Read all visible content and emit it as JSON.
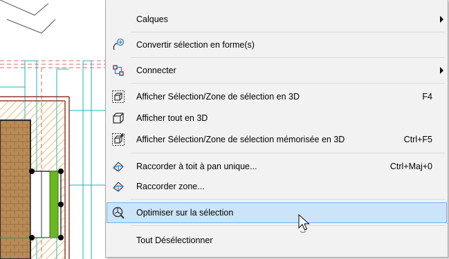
{
  "menu": {
    "items": [
      {
        "label": "Calques",
        "submenu": true
      },
      {
        "label": "Convertir sélection en forme(s)",
        "icon": "convert-shape-icon"
      },
      {
        "label": "Connecter",
        "icon": "connect-icon",
        "submenu": true
      },
      {
        "label": "Afficher Sélection/Zone de sélection en 3D",
        "shortcut": "F4",
        "icon": "show-selection-3d-icon"
      },
      {
        "label": "Afficher tout en 3D",
        "icon": "show-all-3d-icon"
      },
      {
        "label": "Afficher Sélection/Zone de sélection mémorisée en 3D",
        "shortcut": "Ctrl+F5",
        "icon": "show-stored-selection-3d-icon"
      },
      {
        "label": "Raccorder à toit à pan unique...",
        "shortcut": "Ctrl+Maj+0",
        "icon": "trim-roof-icon"
      },
      {
        "label": "Raccorder zone...",
        "icon": "trim-zone-icon"
      },
      {
        "label": "Optimiser sur la sélection",
        "icon": "optimize-selection-icon",
        "highlighted": true
      },
      {
        "label": "Tout Désélectionner"
      }
    ]
  },
  "colors": {
    "highlight": "#cce4f7",
    "highlight_border": "#7aaee0",
    "cyan_lines": "#18b4b4",
    "red_dashes": "#e06060",
    "hatch_orange": "#e8a040",
    "wall_green": "#6ab820",
    "brick": "#b88a55"
  }
}
